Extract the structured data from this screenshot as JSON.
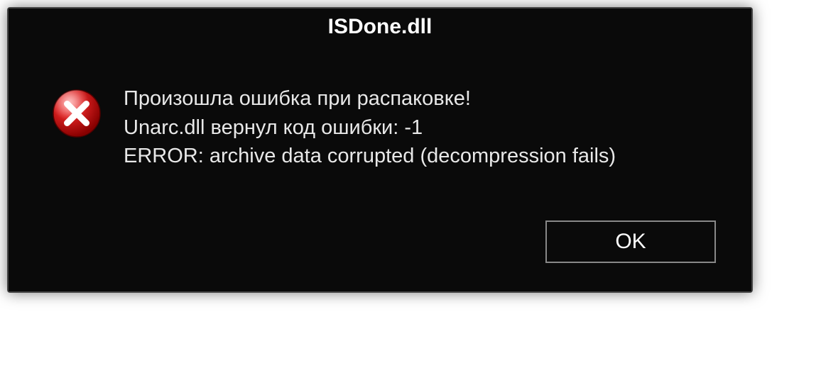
{
  "dialog": {
    "title": "ISDone.dll",
    "icon": "error-icon",
    "messages": {
      "line1": "Произошла ошибка при распаковке!",
      "line2": "Unarc.dll вернул код ошибки: -1",
      "line3": "ERROR: archive data corrupted (decompression fails)"
    },
    "buttons": {
      "ok_label": "OK"
    }
  }
}
